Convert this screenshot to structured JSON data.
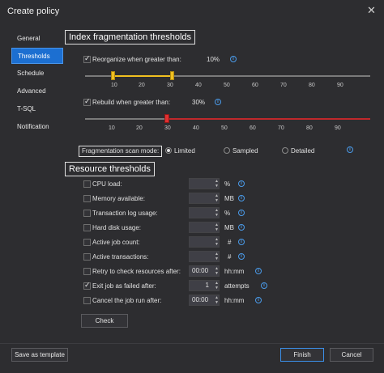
{
  "window": {
    "title": "Create policy",
    "close_glyph": "✕"
  },
  "nav": [
    {
      "label": "General"
    },
    {
      "label": "Thresholds"
    },
    {
      "label": "Schedule"
    },
    {
      "label": "Advanced"
    },
    {
      "label": "T-SQL"
    },
    {
      "label": "Notification"
    }
  ],
  "index_fragmentation": {
    "title": "Index fragmentation thresholds",
    "reorganize": {
      "label": "Reorganize when greater than:",
      "value": "10%",
      "checked": true,
      "low": 10,
      "high": 30
    },
    "rebuild": {
      "label": "Rebuild when greater than:",
      "value": "30%",
      "checked": true,
      "value_num": 30
    },
    "ticks_top": [
      "10",
      "20",
      "30",
      "40",
      "50",
      "60",
      "70",
      "80",
      "90"
    ],
    "ticks_bottom": [
      "10",
      "20",
      "30",
      "40",
      "50",
      "60",
      "70",
      "80",
      "90"
    ],
    "scan_mode": {
      "label": "Fragmentation scan mode:",
      "options": [
        "Limited",
        "Sampled",
        "Detailed"
      ],
      "selected": "Limited"
    }
  },
  "resource_thresholds": {
    "title": "Resource thresholds",
    "rows": [
      {
        "label": "CPU load:",
        "value": "",
        "unit": "%",
        "checked": false,
        "info": true
      },
      {
        "label": "Memory available:",
        "value": "",
        "unit": "MB",
        "checked": false,
        "info": true
      },
      {
        "label": "Transaction log usage:",
        "value": "",
        "unit": "%",
        "checked": false,
        "info": true
      },
      {
        "label": "Hard disk usage:",
        "value": "",
        "unit": "MB",
        "checked": false,
        "info": true
      },
      {
        "label": "Active job count:",
        "value": "",
        "unit": "#",
        "checked": false,
        "info": true
      },
      {
        "label": "Active transactions:",
        "value": "",
        "unit": "#",
        "checked": false,
        "info": true
      },
      {
        "label": "Retry to check resources after:",
        "value": "00:00",
        "unit": "hh:mm",
        "checked": false,
        "info": true
      },
      {
        "label": "Exit job as failed after:",
        "value": "1",
        "unit": "attempts",
        "checked": true,
        "info": true
      },
      {
        "label": "Cancel the job run after:",
        "value": "00:00",
        "unit": "hh:mm",
        "checked": false,
        "info": true
      }
    ],
    "check_button": "Check"
  },
  "footer": {
    "save_template": "Save as template",
    "finish": "Finish",
    "cancel": "Cancel"
  },
  "colors": {
    "accent": "#1c6fd1",
    "reorganize_handle": "#f0c020",
    "rebuild_handle": "#e03030",
    "rebuild_track": "#c0282b"
  },
  "icons": {
    "info": "i",
    "spin_up": "▲",
    "spin_down": "▼"
  }
}
